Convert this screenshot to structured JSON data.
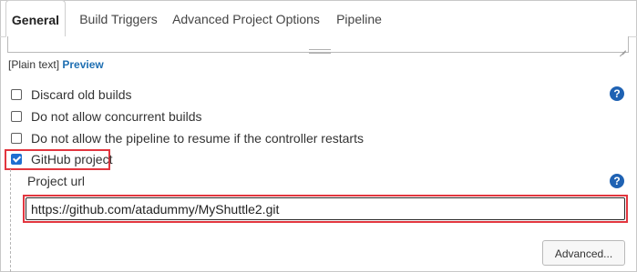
{
  "tabs": [
    {
      "label": "General",
      "active": true
    },
    {
      "label": "Build Triggers",
      "active": false
    },
    {
      "label": "Advanced Project Options",
      "active": false
    },
    {
      "label": "Pipeline",
      "active": false
    }
  ],
  "description": {
    "plain_text_label": "[Plain text]",
    "preview_link": "Preview"
  },
  "options": [
    {
      "label": "Discard old builds",
      "checked": false
    },
    {
      "label": "Do not allow concurrent builds",
      "checked": false
    },
    {
      "label": "Do not allow the pipeline to resume if the controller restarts",
      "checked": false
    },
    {
      "label": "GitHub project",
      "checked": true
    }
  ],
  "github": {
    "project_url_label": "Project url",
    "project_url_value": "https://github.com/atadummy/MyShuttle2.git"
  },
  "advanced_button": "Advanced...",
  "help_icon_glyph": "?",
  "colors": {
    "accent_blue": "#1f62b3",
    "link_blue": "#1f6fb2",
    "highlight_red": "#e2363f",
    "checkbox_blue": "#1f6fd1"
  }
}
